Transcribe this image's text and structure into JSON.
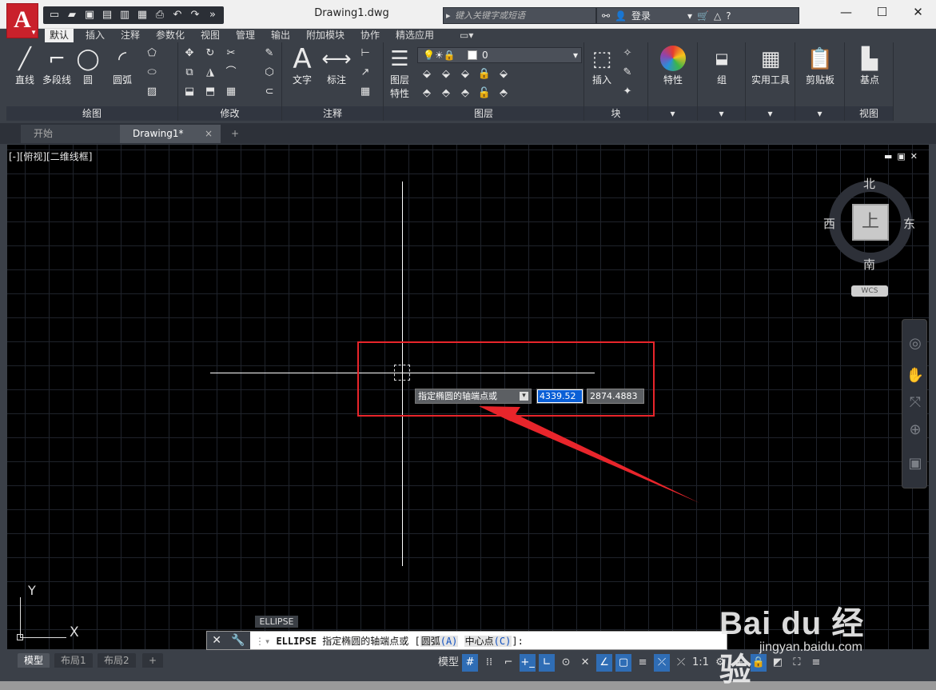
{
  "app": {
    "doc_title": "Drawing1.dwg",
    "search_placeholder": "键入关键字或短语",
    "login_label": "登录"
  },
  "colors": {
    "accent_red": "#c9212b",
    "annotation_red": "#e8252b",
    "highlight_blue": "#0a5fd6",
    "bg_dark": "#3b4048"
  },
  "window_controls": {
    "minimize": "—",
    "maximize": "☐",
    "close": "✕"
  },
  "ribbon_tabs": [
    "默认",
    "插入",
    "注释",
    "参数化",
    "视图",
    "管理",
    "输出",
    "附加模块",
    "协作",
    "精选应用"
  ],
  "ribbon": {
    "draw": {
      "title": "绘图",
      "line": "直线",
      "polyline": "多段线",
      "circle": "圆",
      "arc": "圆弧"
    },
    "modify": {
      "title": "修改"
    },
    "annotation": {
      "title": "注释",
      "text": "文字",
      "dimension": "标注"
    },
    "layers": {
      "title": "图层",
      "properties_line1": "图层",
      "properties_line2": "特性",
      "current_layer": "0"
    },
    "block": {
      "title": "块",
      "insert": "插入"
    },
    "properties": {
      "label": "特性"
    },
    "groups": {
      "label": "组"
    },
    "utilities": {
      "label": "实用工具"
    },
    "clipboard": {
      "label": "剪贴板"
    },
    "view": {
      "title": "视图",
      "base": "基点"
    }
  },
  "file_tabs": {
    "start": "开始",
    "drawing": "Drawing1*",
    "close": "×",
    "add": "+"
  },
  "viewport": {
    "label": "[-][俯视][二维线框]",
    "prompt_text": "指定椭圆的轴端点或",
    "input_x": "4339.52",
    "input_y": "2874.4883",
    "command_tag": "ELLIPSE"
  },
  "viewcube": {
    "north": "北",
    "south": "南",
    "east": "东",
    "west": "西",
    "face": "上",
    "wcs": "WCS"
  },
  "ucs": {
    "y": "Y",
    "x": "X"
  },
  "command_line": {
    "command": "ELLIPSE",
    "text": "指定椭圆的轴端点或 [",
    "opt1": "圆弧",
    "opt1_key": "(A)",
    "opt2": "中心点",
    "opt2_key": "(C)",
    "tail": "]:"
  },
  "layout_tabs": [
    "模型",
    "布局1",
    "布局2"
  ],
  "status": {
    "model": "模型",
    "scale": "1:1"
  },
  "watermark": {
    "main": "Bai du 经验",
    "sub": "jingyan.baidu.com"
  }
}
